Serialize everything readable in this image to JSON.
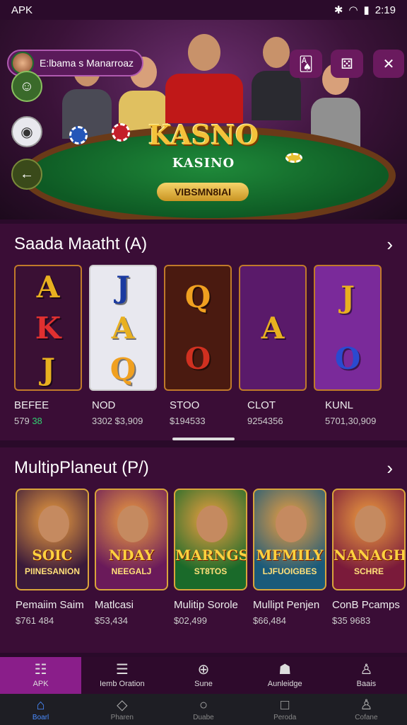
{
  "status_bar": {
    "app_label": "APK",
    "time": "2:19"
  },
  "hero": {
    "logo_main": "KASNO",
    "logo_sub": "KASINO",
    "pill_label": "VIBSMN8IAI",
    "user_name": "E:lbama s Manarroaz"
  },
  "section_one": {
    "title": "Saada Maatht (A)",
    "cards": [
      {
        "name": "BEFEE",
        "value_main": "579",
        "value_accent": "38",
        "letters": [
          "A",
          "K",
          "J"
        ],
        "bg": "#3a1034"
      },
      {
        "name": "NOD",
        "value_main": "3302 $3,909",
        "value_accent": "",
        "letters": [
          "J",
          "A",
          "Q"
        ],
        "bg": "#e8e8ef"
      },
      {
        "name": "STOO",
        "value_main": "$194533",
        "value_accent": "",
        "letters": [
          "Q",
          "O"
        ],
        "bg": "#4a1a10"
      },
      {
        "name": "CLOT",
        "value_main": "9254356",
        "value_accent": "",
        "letters": [
          "A"
        ],
        "bg": "#5a1a6a"
      },
      {
        "name": "KUNL",
        "value_main": "5701,30,909",
        "value_accent": "",
        "letters": [
          "J",
          "O"
        ],
        "bg": "#7a2a9a"
      }
    ]
  },
  "section_two": {
    "title": "MultipPlaneut (P/)",
    "cards": [
      {
        "name": "Pemaiim Saim",
        "value": "$761 484",
        "title": "SOIC",
        "sub": "PIINESANION",
        "bg": "#3a1a3a"
      },
      {
        "name": "Matlcasi",
        "value": "$53,434",
        "title": "NDAY",
        "sub": "NEEGALJ",
        "bg": "#6a1a5a"
      },
      {
        "name": "Mulitip Sorole",
        "value": "$02,499",
        "title": "MARNGS",
        "sub": "ST8TOS",
        "bg": "#1a6a2a"
      },
      {
        "name": "Mullipt Penjen",
        "value": "$66,484",
        "title": "MFMILY",
        "sub": "LJFUOIGBES",
        "bg": "#1a5a7a"
      },
      {
        "name": "ConB Pcamps",
        "value": "$35 9683",
        "title": "NANAGH",
        "sub": "SCHRE",
        "bg": "#7a1a3a"
      }
    ]
  },
  "tabs": [
    {
      "label": "APK",
      "icon": "grid-icon"
    },
    {
      "label": "Iemb Oration",
      "icon": "list-icon"
    },
    {
      "label": "Sune",
      "icon": "compass-icon"
    },
    {
      "label": "Aunleidge",
      "icon": "group-icon"
    },
    {
      "label": "Baais",
      "icon": "person-icon"
    }
  ],
  "nav": [
    {
      "label": "Boarl",
      "icon": "home-icon"
    },
    {
      "label": "Pharen",
      "icon": "diamond-icon"
    },
    {
      "label": "Duabe",
      "icon": "search-icon"
    },
    {
      "label": "Peroda",
      "icon": "square-icon"
    },
    {
      "label": "Cofane",
      "icon": "user-icon"
    }
  ]
}
